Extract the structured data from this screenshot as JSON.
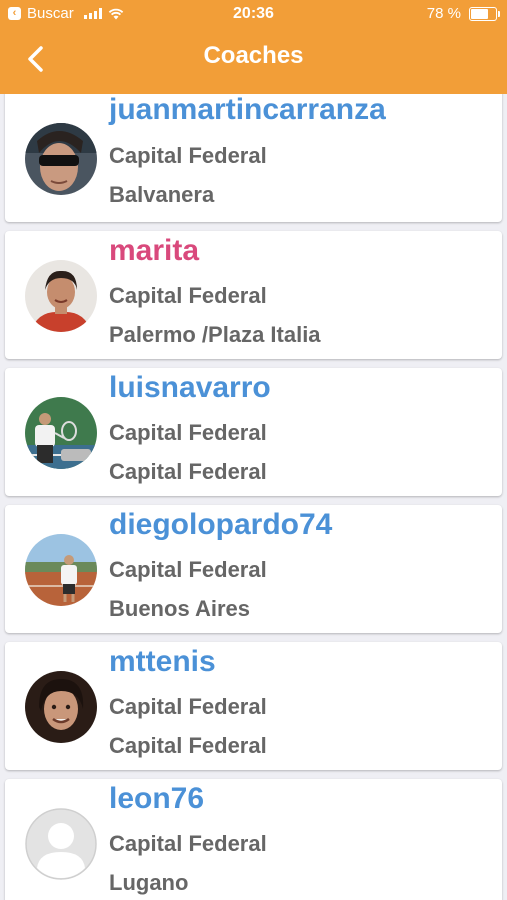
{
  "status_bar": {
    "back_app_label": "Buscar",
    "time": "20:36",
    "battery_percent": "78 %",
    "battery_level": 0.78
  },
  "header": {
    "title": "Coaches",
    "back_icon": "chevron-left-icon",
    "color": "#f29e38"
  },
  "colors": {
    "name_blue": "#4b91d7",
    "name_pink": "#d9497c",
    "text_gray": "#666666"
  },
  "coaches": [
    {
      "username": "juanmartincarranza",
      "line1": "Capital Federal",
      "line2": "Balvanera",
      "name_color": "#4b91d7",
      "avatar": "photo-sunglasses"
    },
    {
      "username": "marita",
      "line1": "Capital Federal",
      "line2": "Palermo /Plaza Italia",
      "name_color": "#d9497c",
      "avatar": "photo-woman"
    },
    {
      "username": "luisnavarro",
      "line1": "Capital Federal",
      "line2": "Capital Federal",
      "name_color": "#4b91d7",
      "avatar": "photo-tennis-court"
    },
    {
      "username": "diegolopardo74",
      "line1": "Capital Federal",
      "line2": "Buenos Aires",
      "name_color": "#4b91d7",
      "avatar": "photo-clay-court"
    },
    {
      "username": "mttenis",
      "line1": "Capital Federal",
      "line2": "Capital Federal",
      "name_color": "#4b91d7",
      "avatar": "photo-man"
    },
    {
      "username": "leon76",
      "line1": "Capital Federal",
      "line2": "Lugano",
      "name_color": "#4b91d7",
      "avatar": "default-avatar-icon"
    }
  ]
}
